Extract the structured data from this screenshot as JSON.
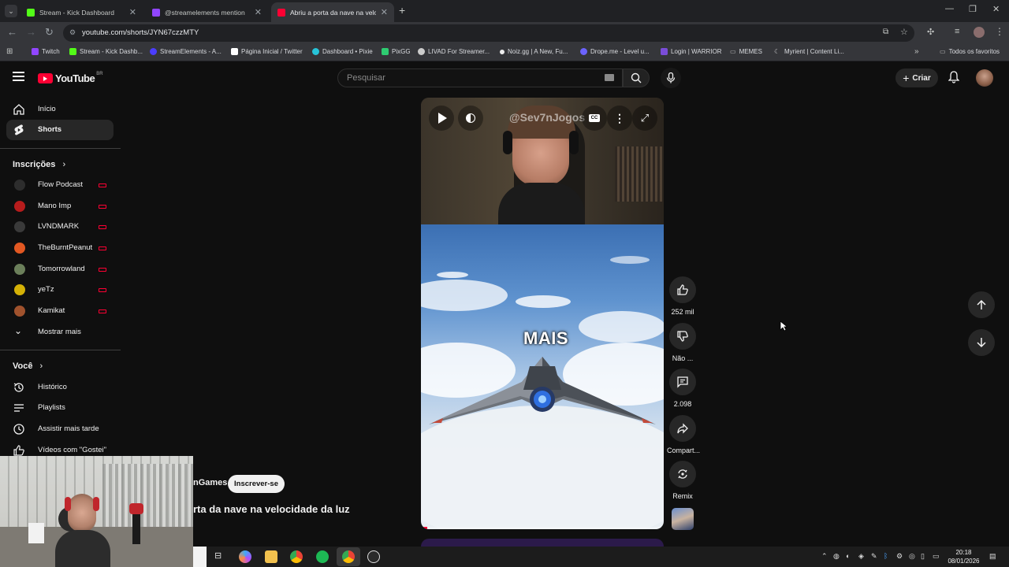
{
  "browser": {
    "tabs": [
      {
        "title": "Stream - Kick Dashboard",
        "favicon_color": "#53fc18"
      },
      {
        "title": "@streamelements mention",
        "favicon_color": "#9146ff"
      },
      {
        "title": "Abriu a porta da nave na veloc",
        "favicon_color": "#ff0033"
      }
    ],
    "new_tab": "+",
    "url": "youtube.com/shorts/JYN67czzMTY",
    "bookmarks": [
      {
        "label": "Twitch",
        "color": "#9146ff"
      },
      {
        "label": "Stream - Kick Dashb...",
        "color": "#53fc18"
      },
      {
        "label": "StreamElements - A...",
        "color": "#4b3dff"
      },
      {
        "label": "Página Inicial / Twitter",
        "color": "#ffffff"
      },
      {
        "label": "Dashboard • Pixie",
        "color": "#27c4d9"
      },
      {
        "label": "PixGG",
        "color": "#2ecc71"
      },
      {
        "label": "LIVAD For Streamer...",
        "color": "#cccccc"
      },
      {
        "label": "Noiz.gg | A New, Fu...",
        "color": "#eeeeee"
      },
      {
        "label": "Drope.me - Level u...",
        "color": "#6c63ff"
      },
      {
        "label": "Login | WARRIOR",
        "color": "#7a4dd8"
      },
      {
        "label": "MEMES",
        "color": "#bbbbbb"
      },
      {
        "label": "Myrient | Content Li...",
        "color": "#dddddd"
      }
    ],
    "all_bookmarks": "Todos os favoritos"
  },
  "youtube": {
    "logo": "YouTube",
    "country": "BR",
    "search_placeholder": "Pesquisar",
    "create_label": "Criar",
    "sidebar": {
      "home": "Início",
      "shorts": "Shorts",
      "subscriptions_header": "Inscrições",
      "subscriptions": [
        {
          "name": "Flow Podcast",
          "color": "#2d2d2d"
        },
        {
          "name": "Mano Imp",
          "color": "#b71c1c"
        },
        {
          "name": "LVNDMARK",
          "color": "#3a3a3a"
        },
        {
          "name": "TheBurntPeanut",
          "color": "#e25822"
        },
        {
          "name": "Tomorrowland",
          "color": "#6b7f5a"
        },
        {
          "name": "yeTz",
          "color": "#d4b106"
        },
        {
          "name": "Kamikat",
          "color": "#a0522d"
        }
      ],
      "show_more": "Mostrar mais",
      "you_header": "Você",
      "you_items": [
        "Histórico",
        "Playlists",
        "Assistir mais tarde",
        "Vídeos com \"Gostei\""
      ]
    },
    "short": {
      "channel_handle": "@Sev7nJogos",
      "caption": "MAIS",
      "channel_name": "nGames",
      "subscribe": "Inscrever-se",
      "title": "rta da nave na velocidade da luz",
      "actions": {
        "likes": "252 mil",
        "dislike": "Não ...",
        "comments": "2.098",
        "share": "Compart...",
        "remix": "Remix"
      }
    }
  },
  "taskbar": {
    "time": "20:18",
    "date": "08/01/2026"
  }
}
